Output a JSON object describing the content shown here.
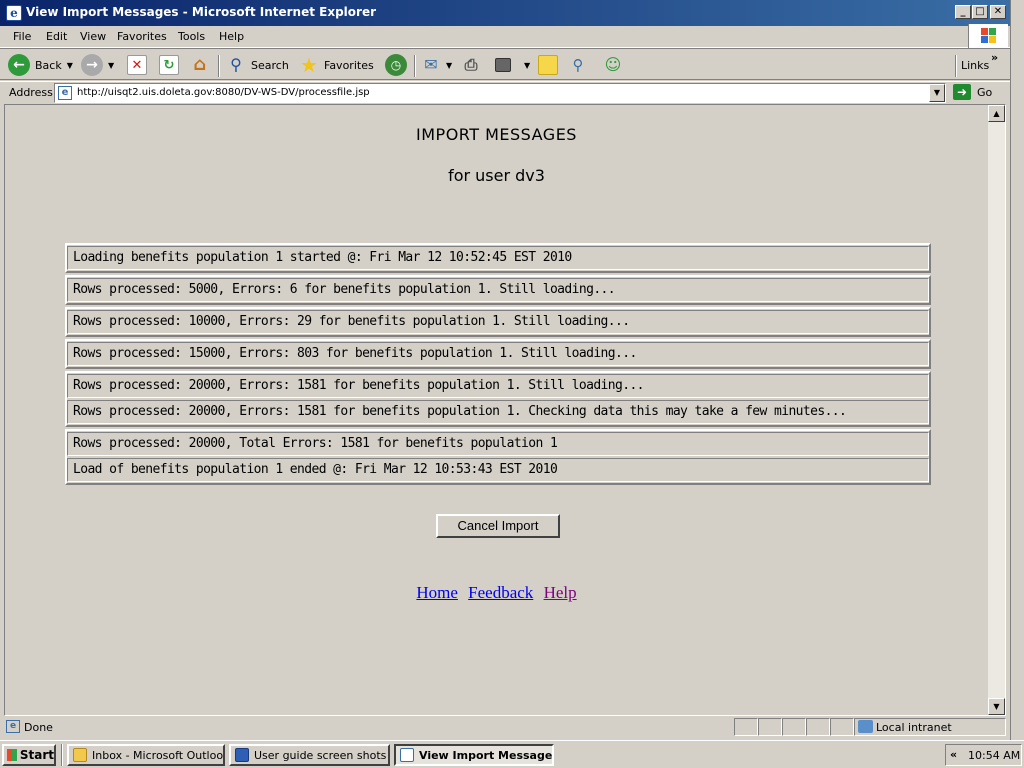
{
  "window": {
    "title": "View Import Messages - Microsoft Internet Explorer",
    "minimize": "_",
    "maximize": "□",
    "close": "✕"
  },
  "menu": [
    "File",
    "Edit",
    "View",
    "Favorites",
    "Tools",
    "Help"
  ],
  "toolbar": {
    "back_label": "Back",
    "search_label": "Search",
    "favorites_label": "Favorites",
    "links_label": "Links"
  },
  "address": {
    "label": "Address",
    "url": "http://uisqt2.uis.doleta.gov:8080/DV-WS-DV/processfile.jsp",
    "go_label": "Go"
  },
  "page": {
    "title": "IMPORT MESSAGES",
    "subtitle": "for user dv3",
    "message_groups": [
      [
        "Loading benefits population 1 started @: Fri Mar 12 10:52:45 EST 2010"
      ],
      [
        "Rows processed: 5000, Errors: 6 for benefits population 1. Still loading..."
      ],
      [
        "Rows processed: 10000, Errors: 29 for benefits population 1. Still loading..."
      ],
      [
        "Rows processed: 15000, Errors: 803 for benefits population 1. Still loading..."
      ],
      [
        "Rows processed: 20000, Errors: 1581 for benefits population 1. Still loading...",
        "Rows processed: 20000, Errors: 1581 for benefits population 1. Checking data this may take a few minutes..."
      ],
      [
        "Rows processed: 20000, Total Errors: 1581 for benefits population 1",
        "Load of benefits population 1 ended @: Fri Mar 12 10:53:43 EST 2010"
      ]
    ],
    "cancel_button": "Cancel Import",
    "links": {
      "home": "Home",
      "feedback": "Feedback",
      "help": "Help"
    }
  },
  "status": {
    "text": "Done",
    "zone": "Local intranet"
  },
  "taskbar": {
    "start": "Start",
    "tasks": [
      {
        "label": "Inbox - Microsoft Outlook",
        "active": false
      },
      {
        "label": "User guide screen shots ...",
        "active": false
      },
      {
        "label": "View Import Message...",
        "active": true
      }
    ],
    "clock": "10:54 AM",
    "tray_chevron": "«"
  },
  "colors": {
    "titlebar_start": "#0a246a",
    "titlebar_end": "#3a6ea5",
    "link": "#0000ee",
    "visited_link": "#800080",
    "chrome": "#d4d0c8"
  }
}
